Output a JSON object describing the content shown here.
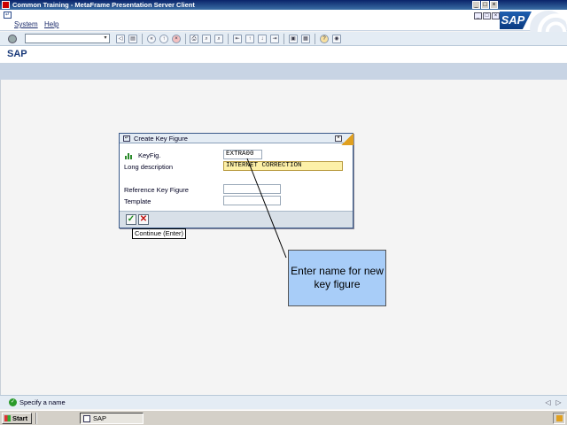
{
  "window": {
    "title": "Common Training - MetaFrame Presentation Server Client"
  },
  "menubar": {
    "items": [
      "System",
      "Help"
    ],
    "logo": "SAP"
  },
  "toolbar": {
    "command_field": ""
  },
  "screen": {
    "title": "SAP"
  },
  "dialog": {
    "title": "Create Key Figure",
    "keyfig_label": "KeyFig.",
    "keyfig_value": "EXTRA00",
    "longdesc_label": "Long description",
    "longdesc_value": "INTERNET CORRECTION",
    "refkf_label": "Reference Key Figure",
    "refkf_value": "",
    "template_label": "Template",
    "template_value": ""
  },
  "tooltip": {
    "text": "Continue   (Enter)"
  },
  "callout": {
    "text": "Enter name for new key figure"
  },
  "status": {
    "message": "Specify a name"
  },
  "taskbar": {
    "start_label": "Start",
    "task_label": "SAP"
  },
  "colors": {
    "callout_fill": "#a8cdf8",
    "active_field": "#fdf0a8",
    "title_blue": "#1a3a7a"
  }
}
